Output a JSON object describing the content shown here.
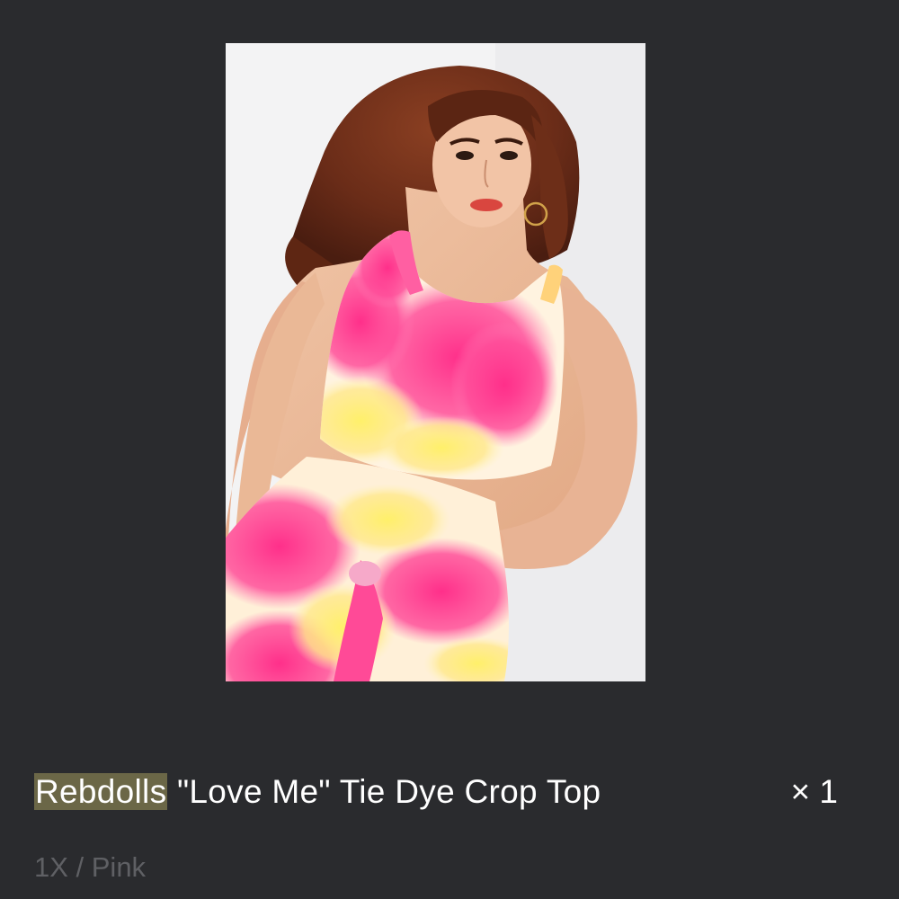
{
  "product": {
    "brand": "Rebdolls",
    "title_rest": " \"Love Me\" Tie Dye Crop Top",
    "quantity": "× 1",
    "variant": "1X / Pink"
  },
  "colors": {
    "background": "#2a2b2e",
    "highlight": "#6b6747",
    "text": "#ffffff",
    "muted_text": "#5f6064"
  }
}
